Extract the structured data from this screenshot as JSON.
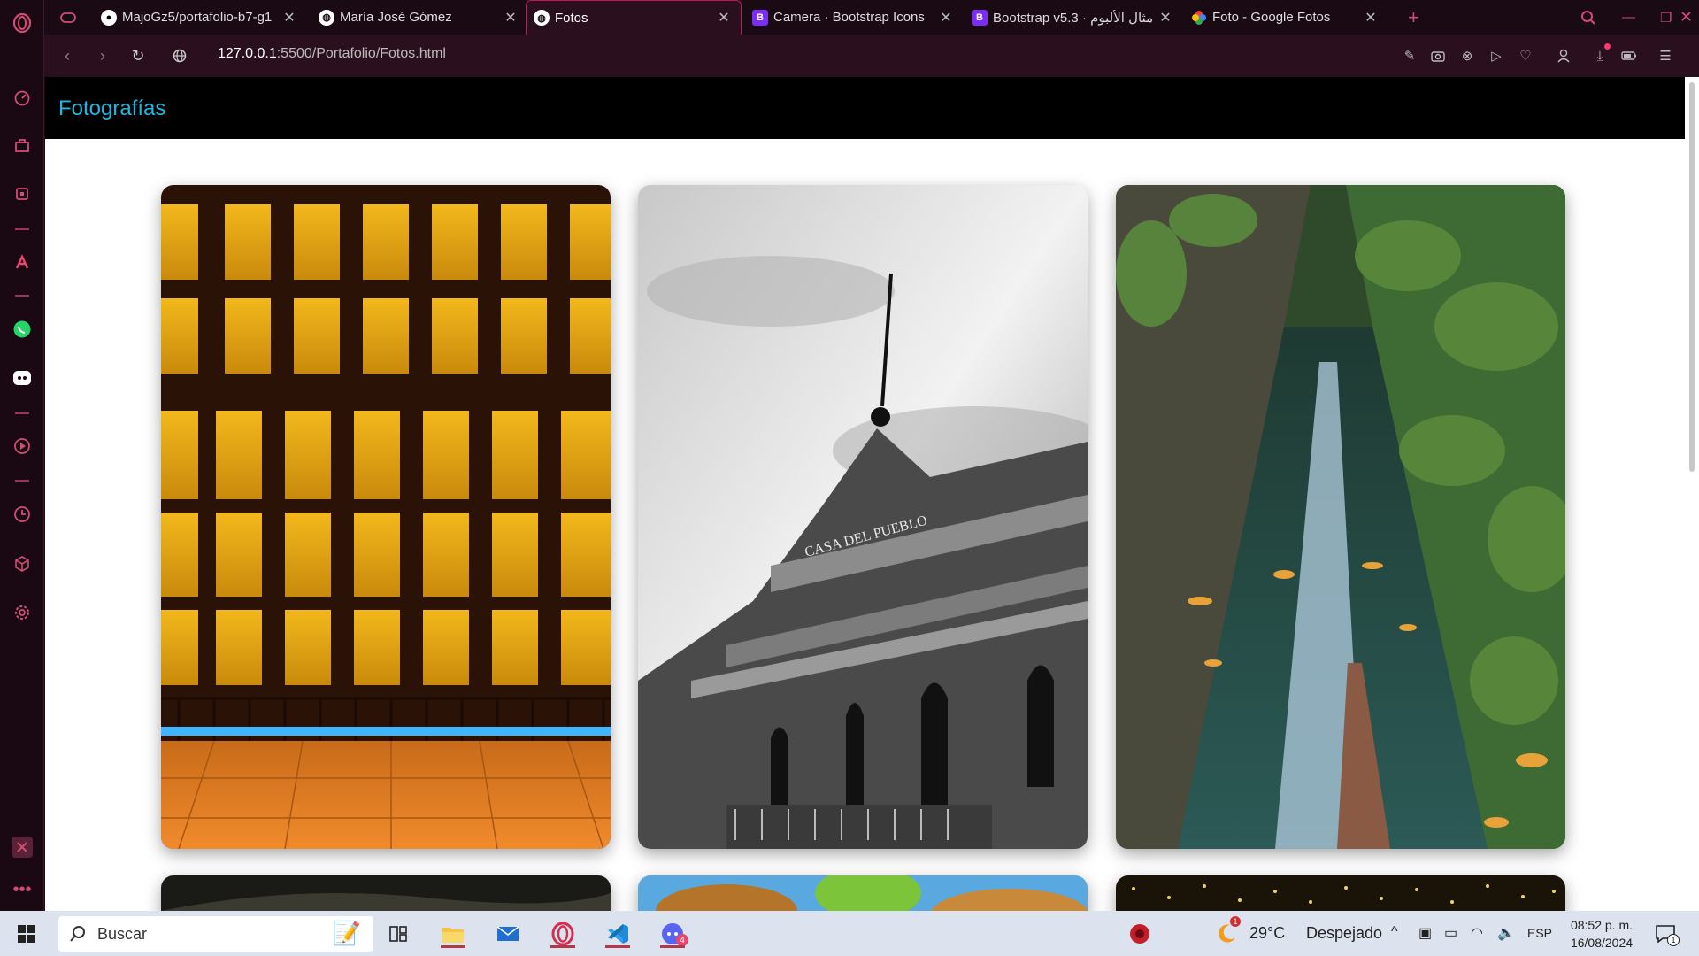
{
  "browser": {
    "tabs": [
      {
        "title": "",
        "favicon": "gamepad-icon"
      },
      {
        "title": "MajoGz5/portafolio-b7-g1",
        "favicon": "github-icon"
      },
      {
        "title": "María José Gómez",
        "favicon": "globe-icon"
      },
      {
        "title": "Fotos",
        "favicon": "globe-icon",
        "active": true
      },
      {
        "title": "Camera · Bootstrap Icons",
        "favicon": "bootstrap-icon"
      },
      {
        "title": "Bootstrap v5.3 · مثال الألبوم",
        "favicon": "bootstrap-icon"
      },
      {
        "title": "Foto - Google Fotos",
        "favicon": "google-photos-icon"
      }
    ],
    "address": {
      "url_host": "127.0.0.1",
      "url_rest": ":5500/Portafolio/Fotos.html"
    },
    "accent_color": "#c2185b"
  },
  "page": {
    "brand": "Fotografías",
    "brand_color": "#1fb8e0",
    "photos": [
      {
        "subject": "golden-window-panes-photo"
      },
      {
        "subject": "casa-del-pueblo-building-photo",
        "sign_text": "CASA DEL PUEBLO"
      },
      {
        "subject": "jungle-canal-reflection-photo"
      },
      {
        "subject": "dark-landscape-photo"
      },
      {
        "subject": "tropical-plant-photo"
      },
      {
        "subject": "string-lights-photo"
      }
    ]
  },
  "taskbar": {
    "search_placeholder": "Buscar",
    "weather_temp": "29°C",
    "weather_desc": "Despejado",
    "language": "ESP",
    "time": "08:52 p. m.",
    "date": "16/08/2024",
    "notification_count": "1",
    "discord_badge": "4"
  }
}
